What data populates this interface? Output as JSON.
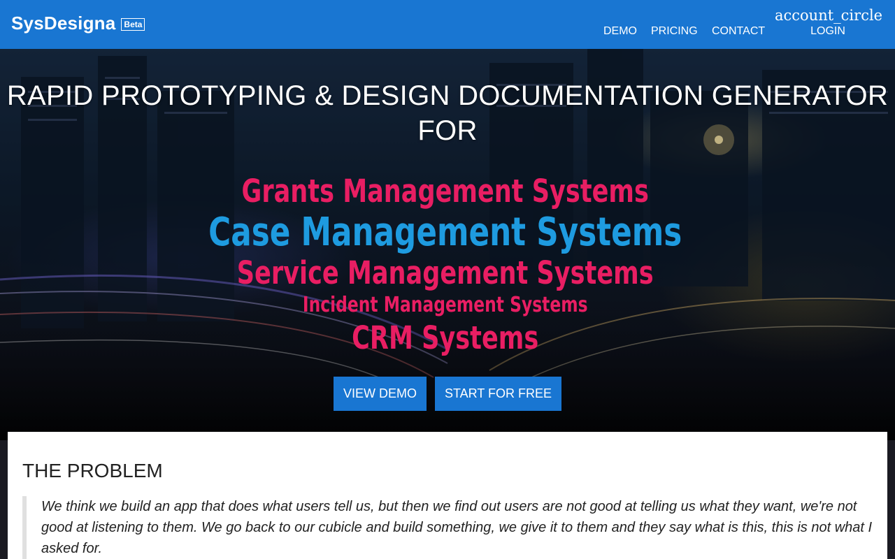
{
  "header": {
    "brand": "SysDesigna",
    "badge": "Beta",
    "nav": {
      "demo": "DEMO",
      "pricing": "PRICING",
      "contact": "CONTACT"
    },
    "account": {
      "icon_text": "account_circle",
      "label": "LOGIN"
    },
    "color": "#1976d2"
  },
  "hero": {
    "title": "RAPID PROTOTYPING & DESIGN DOCUMENTATION GENERATOR FOR",
    "systems": [
      "Grants Management Systems",
      "Case Management Systems",
      "Service Management Systems",
      "Incident Management Systems",
      "CRM Systems"
    ],
    "buttons": {
      "view_demo": "VIEW DEMO",
      "start_free": "START FOR FREE"
    },
    "accent_pink": "#e91e63",
    "accent_blue": "#1e9be0"
  },
  "problem": {
    "title": "THE PROBLEM",
    "quote": "We think we build an app that does what users tell us, but then we find out users are not good at telling us what they want, we're not good at listening to them. We go back to our cubicle and build something, we give it to them and they say what is this, this is not what I asked for."
  }
}
